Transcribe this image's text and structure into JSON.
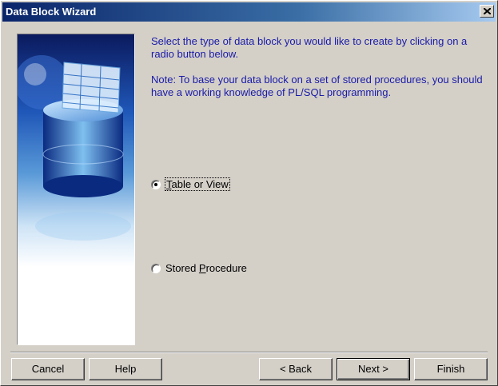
{
  "window": {
    "title": "Data Block Wizard",
    "close_label": "Close"
  },
  "content": {
    "description": "Select the type of data block you would like to create by clicking on a radio button below.",
    "note": "Note: To base your data block on a set of stored procedures, you should have a working knowledge of PL/SQL programming."
  },
  "options": {
    "table_or_view": {
      "accel": "T",
      "rest": "able or View",
      "selected": true
    },
    "stored_procedure": {
      "before": "Stored ",
      "accel": "P",
      "rest": "rocedure",
      "selected": false
    }
  },
  "buttons": {
    "cancel": "Cancel",
    "help": "Help",
    "back": "< Back",
    "next": "Next >",
    "finish": "Finish"
  },
  "colors": {
    "title_gradient_start": "#0a246a",
    "title_gradient_end": "#a6caf0",
    "instruction_text": "#1a1aa8",
    "dialog_background": "#d4d0c8"
  }
}
